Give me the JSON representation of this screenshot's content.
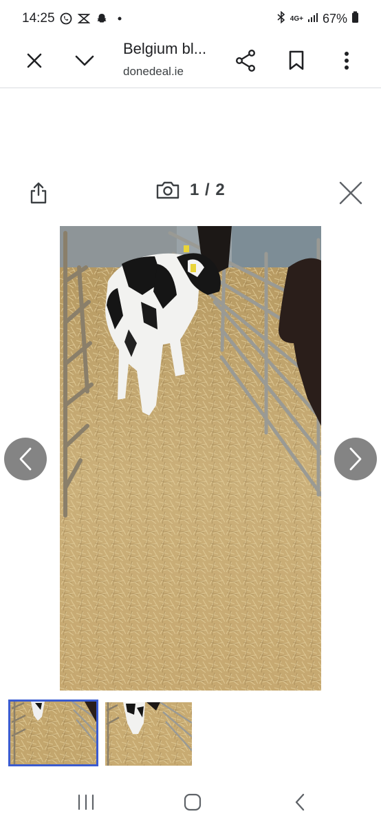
{
  "status": {
    "time": "14:25",
    "network": "4G+",
    "battery": "67%"
  },
  "top_bar": {
    "title": "Belgium bl...",
    "domain": "donedeal.ie"
  },
  "viewer": {
    "counter": "1 / 2"
  },
  "icons": [
    "whatsapp-icon",
    "notification-icon",
    "snapchat-icon",
    "bluetooth-icon",
    "signal-icon",
    "battery-icon",
    "close-icon",
    "chevron-down-icon",
    "share-icon",
    "bookmark-icon",
    "more-vert-icon",
    "camera-icon",
    "prev-arrow-icon",
    "next-arrow-icon",
    "recents-icon",
    "home-icon",
    "back-icon"
  ],
  "colors": {
    "thumb_selected_border": "#3a5bd0",
    "arrow_bg": "#6e6e6e",
    "straw": "#c9a86a"
  }
}
